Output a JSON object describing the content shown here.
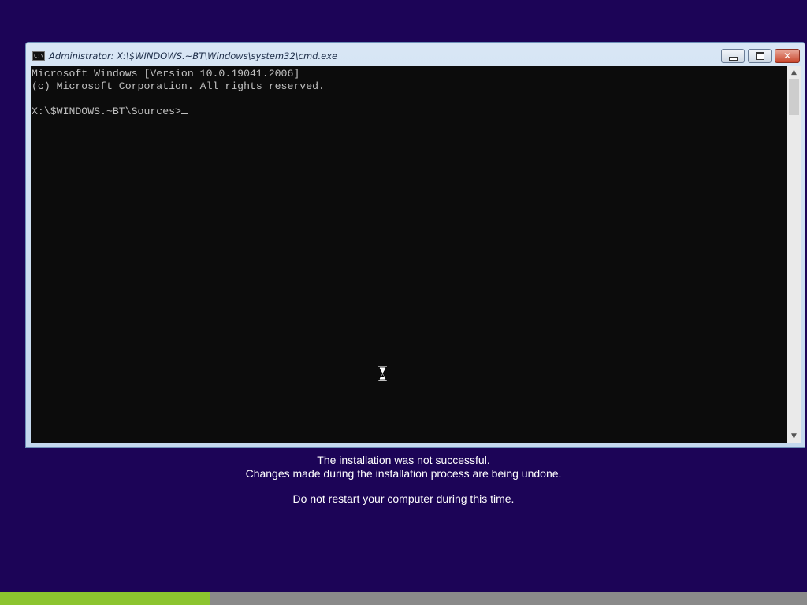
{
  "window": {
    "title": "Administrator: X:\\$WINDOWS.~BT\\Windows\\system32\\cmd.exe",
    "icon": "cmd-icon",
    "icon_label": "C:\\"
  },
  "console": {
    "lines": [
      "Microsoft Windows [Version 10.0.19041.2006]",
      "(c) Microsoft Corporation. All rights reserved.",
      "",
      "X:\\$WINDOWS.~BT\\Sources>"
    ]
  },
  "status": {
    "line1": "The installation was not successful.",
    "line2": "Changes made during the installation process are being undone.",
    "line3": "Do not restart your computer during this time."
  },
  "progress": {
    "fraction": 0.26,
    "fill_color": "#8cc42f",
    "track_color": "#8a8a8a"
  },
  "colors": {
    "background": "#1c0457",
    "console_bg": "#0c0c0c",
    "console_text": "#c0c0c0"
  }
}
